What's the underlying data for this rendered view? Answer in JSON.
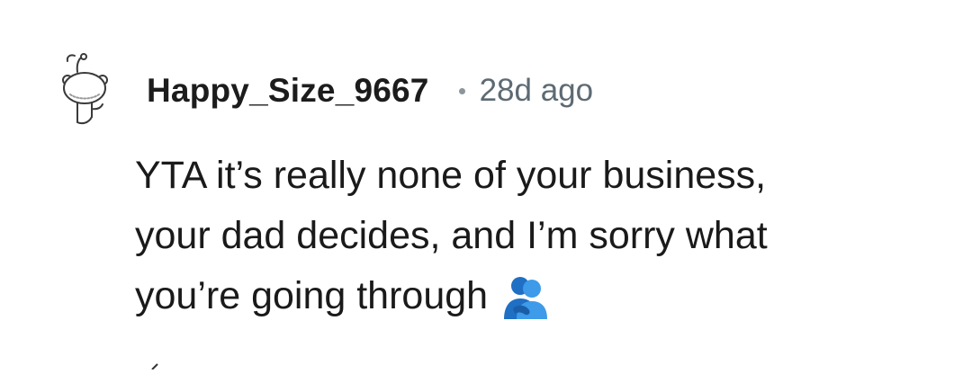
{
  "comment": {
    "author": "Happy_Size_9667",
    "separator_icon": "dot-separator-icon",
    "age": "28d ago",
    "avatar_icon": "snoo-avatar-icon",
    "body_lines": [
      "YTA it’s really none of your business,",
      "your dad decides, and I’m sorry what",
      "you’re going through"
    ],
    "emoji": "people-hugging-emoji-icon"
  },
  "colors": {
    "username": "#1c1c1c",
    "meta": "#5d6a73",
    "text": "#1a1a1a",
    "emoji_blue": "#2f8be0"
  }
}
